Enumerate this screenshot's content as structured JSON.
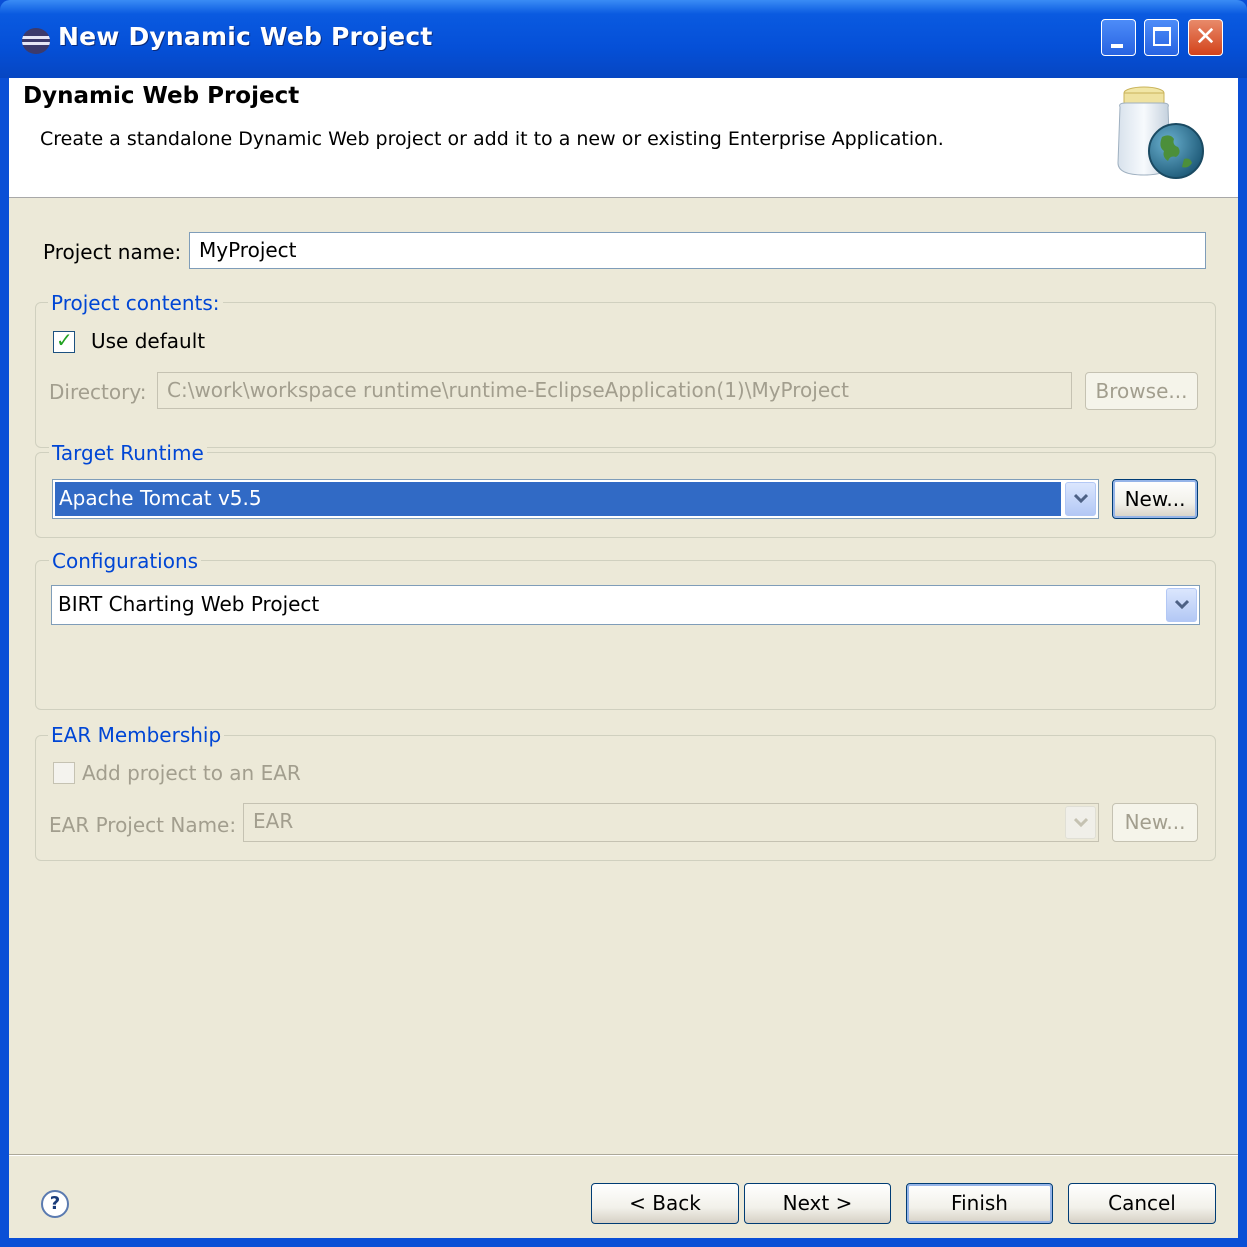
{
  "window": {
    "title": "New Dynamic Web Project",
    "icon": "eclipse-icon"
  },
  "header": {
    "title": "Dynamic Web Project",
    "description": "Create a standalone Dynamic Web project or add it to a new or existing Enterprise Application.",
    "image": "jar-globe-icon"
  },
  "project_name": {
    "label": "Project name:",
    "value": "MyProject"
  },
  "project_contents": {
    "title": "Project contents:",
    "use_default_label": "Use default",
    "use_default_checked": true,
    "directory_label": "Directory:",
    "directory_value": "C:\\work\\workspace runtime\\runtime-EclipseApplication(1)\\MyProject",
    "browse_label": "Browse..."
  },
  "target_runtime": {
    "title": "Target Runtime",
    "selected": "Apache Tomcat v5.5",
    "new_label": "New..."
  },
  "configurations": {
    "title": "Configurations",
    "selected": "BIRT Charting Web Project"
  },
  "ear_membership": {
    "title": "EAR Membership",
    "add_label": "Add project to an EAR",
    "add_checked": false,
    "ear_name_label": "EAR Project Name:",
    "ear_name_value": "EAR",
    "new_label": "New..."
  },
  "footer": {
    "help_icon": "help-icon",
    "back_label": "< Back",
    "next_label": "Next >",
    "finish_label": "Finish",
    "cancel_label": "Cancel"
  },
  "colors": {
    "titlebar": "#0550d8",
    "dialog_bg": "#ece9d8",
    "group_title": "#0046d5",
    "selection": "#316ac5"
  }
}
